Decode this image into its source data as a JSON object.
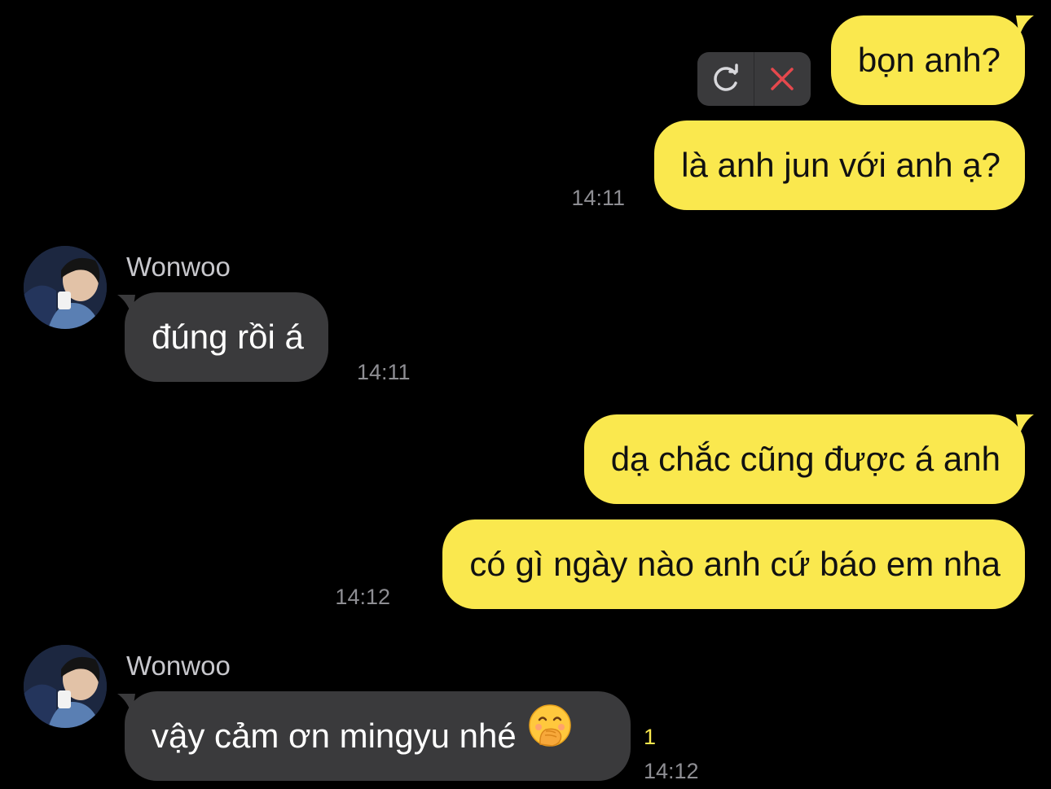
{
  "messages": [
    {
      "id": "m1",
      "from": "me",
      "text": "bọn anh?"
    },
    {
      "id": "m2",
      "from": "me",
      "text": "là anh jun với anh ạ?",
      "time": "14:11"
    },
    {
      "id": "m3",
      "from": "them",
      "sender": "Wonwoo",
      "text": "đúng rồi á",
      "time": "14:11"
    },
    {
      "id": "m4",
      "from": "me",
      "text": "dạ chắc cũng được á anh"
    },
    {
      "id": "m5",
      "from": "me",
      "text": "có gì ngày nào anh cứ báo em nha",
      "time": "14:12"
    },
    {
      "id": "m6",
      "from": "them",
      "sender": "Wonwoo",
      "text": "vậy cảm ơn mingyu nhé",
      "emoji": "face-with-hand-over-mouth-emoji",
      "time": "14:12",
      "unread": "1"
    }
  ],
  "failed_send_controls": {
    "retry_icon": "retry-icon",
    "delete_icon": "close-icon"
  },
  "colors": {
    "background": "#000000",
    "my_bubble": "#fae84e",
    "their_bubble": "#3a3a3c",
    "timestamp": "#8e8e93",
    "unread_count": "#fae84e",
    "delete_x": "#e5484d"
  }
}
